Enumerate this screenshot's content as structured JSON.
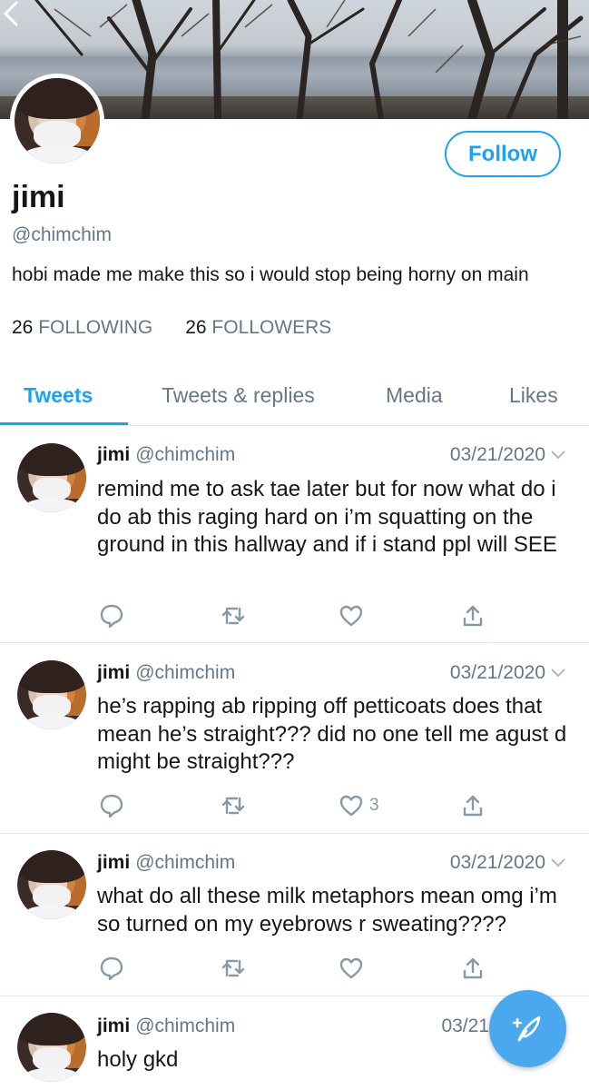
{
  "profile": {
    "name": "jimi",
    "handle": "@chimchim",
    "bio": "hobi made me make this so i would stop being horny on main",
    "following_count": "26",
    "following_label": "FOLLOWING",
    "followers_count": "26",
    "followers_label": "FOLLOWERS",
    "follow_label": "Follow"
  },
  "tabs": [
    {
      "label": "Tweets",
      "active": true
    },
    {
      "label": "Tweets & replies",
      "active": false
    },
    {
      "label": "Media",
      "active": false
    },
    {
      "label": "Likes",
      "active": false
    }
  ],
  "tweets": [
    {
      "name": "jimi",
      "handle": "@chimchim",
      "date": "03/21/2020",
      "text": "remind me to ask tae later but for now what do i do ab this raging hard on i’m squatting on the ground in this hallway and if i stand ppl will SEE",
      "like_count": ""
    },
    {
      "name": "jimi",
      "handle": "@chimchim",
      "date": "03/21/2020",
      "text": "he’s rapping ab ripping off petticoats does that mean he’s straight??? did no one tell me agust d might be straight???",
      "like_count": "3"
    },
    {
      "name": "jimi",
      "handle": "@chimchim",
      "date": "03/21/2020",
      "text": "what do all these milk metaphors mean omg i’m so turned on my eyebrows r sweating????",
      "like_count": ""
    },
    {
      "name": "jimi",
      "handle": "@chimchim",
      "date": "03/21",
      "text": "holy gkd",
      "like_count": ""
    }
  ],
  "colors": {
    "accent": "#1da1f2",
    "text": "#14171a",
    "muted": "#657786",
    "fab": "#4aa8ee"
  },
  "icons": [
    "back-chevron-icon",
    "reply-icon",
    "retweet-icon",
    "like-icon",
    "share-icon",
    "compose-tweet-icon",
    "caret-down-icon"
  ]
}
